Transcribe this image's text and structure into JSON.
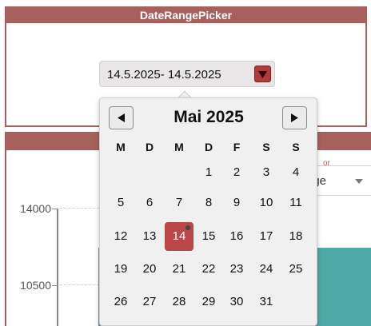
{
  "panel_top": {
    "title": "DateRangePicker",
    "picker_value": "14.5.2025- 14.5.2025"
  },
  "panel_bottom": {
    "floating_label_fragment": "or",
    "select_value_fragment": "age",
    "y_ticks": [
      "14000",
      "10500"
    ]
  },
  "calendar": {
    "month_title": "Mai 2025",
    "weekdays": [
      "M",
      "D",
      "M",
      "D",
      "F",
      "S",
      "S"
    ],
    "weeks": [
      [
        "",
        "",
        "",
        "1",
        "2",
        "3",
        "4"
      ],
      [
        "5",
        "6",
        "7",
        "8",
        "9",
        "10",
        "11"
      ],
      [
        "12",
        "13",
        "14",
        "15",
        "16",
        "17",
        "18"
      ],
      [
        "19",
        "20",
        "21",
        "22",
        "23",
        "24",
        "25"
      ],
      [
        "26",
        "27",
        "28",
        "29",
        "30",
        "31",
        ""
      ]
    ],
    "selected_day": "14",
    "today_day": "14"
  },
  "colors": {
    "header": "#a8605d",
    "selected": "#b9474a",
    "series": "#4ea9a6"
  }
}
